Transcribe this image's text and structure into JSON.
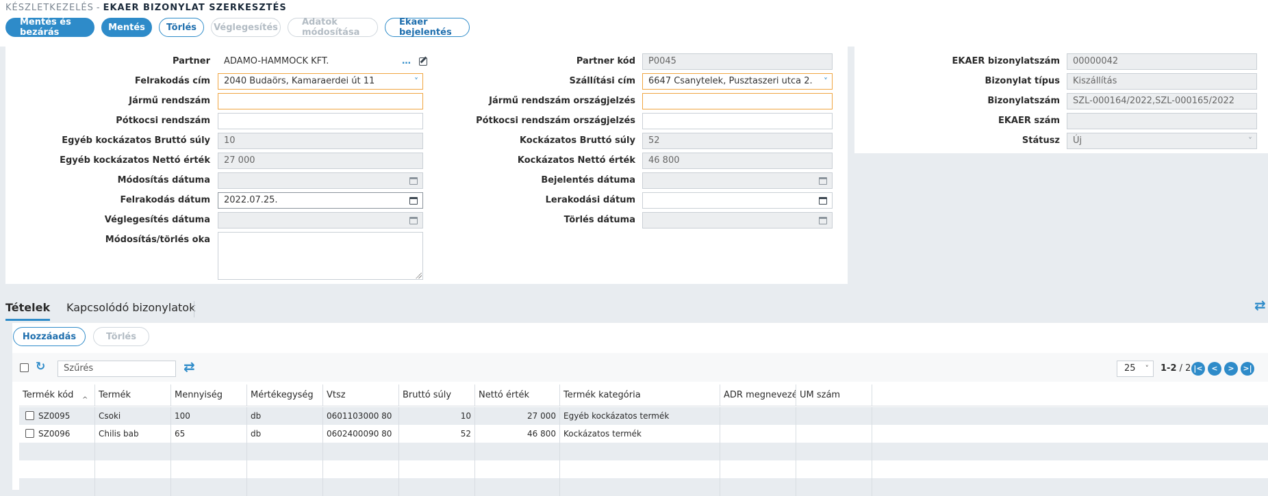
{
  "breadcrumb": {
    "parent": "KÉSZLETKEZELÉS",
    "separator": "-",
    "title": "EKAER BIZONYLAT SZERKESZTÉS"
  },
  "toolbar": {
    "save_close": "Mentés és bezárás",
    "save": "Mentés",
    "delete": "Törlés",
    "finalize": "Véglegesítés",
    "modify_data": "Adatok módosítása",
    "ekaer_report": "Ekaer bejelentés"
  },
  "form_left": {
    "partner": {
      "label": "Partner",
      "value": "ADAMO-HAMMOCK KFT."
    },
    "loading_address": {
      "label": "Felrakodás cím",
      "value": "2040 Budaörs, Kamaraerdei út 11"
    },
    "vehicle_plate": {
      "label": "Jármű rendszám",
      "value": ""
    },
    "trailer_plate": {
      "label": "Pótkocsi rendszám",
      "value": ""
    },
    "other_gross_weight": {
      "label": "Egyéb kockázatos Bruttó súly",
      "value": "10"
    },
    "other_net_value": {
      "label": "Egyéb kockázatos Nettó érték",
      "value": "27 000"
    },
    "modification_date": {
      "label": "Módosítás dátuma",
      "value": ""
    },
    "loading_date": {
      "label": "Felrakodás dátum",
      "value": "2022.07.25."
    },
    "finalize_date": {
      "label": "Véglegesítés dátuma",
      "value": ""
    },
    "reason": {
      "label": "Módosítás/törlés oka",
      "value": ""
    }
  },
  "form_mid": {
    "partner_code": {
      "label": "Partner kód",
      "value": "P0045"
    },
    "shipping_address": {
      "label": "Szállítási cím",
      "value": "6647 Csanytelek, Pusztaszeri utca 2."
    },
    "vehicle_country": {
      "label": "Jármű rendszám országjelzés",
      "value": ""
    },
    "trailer_country": {
      "label": "Pótkocsi rendszám országjelzés",
      "value": ""
    },
    "risk_gross_weight": {
      "label": "Kockázatos Bruttó súly",
      "value": "52"
    },
    "risk_net_value": {
      "label": "Kockázatos Nettó érték",
      "value": "46 800"
    },
    "report_date": {
      "label": "Bejelentés dátuma",
      "value": ""
    },
    "unloading_date": {
      "label": "Lerakodási dátum",
      "value": ""
    },
    "delete_date": {
      "label": "Törlés dátuma",
      "value": ""
    }
  },
  "form_right": {
    "ekaer_doc_no": {
      "label": "EKAER bizonylatszám",
      "value": "00000042"
    },
    "doc_type": {
      "label": "Bizonylat típus",
      "value": "Kiszállítás"
    },
    "doc_no": {
      "label": "Bizonylatszám",
      "value": "SZL-000164/2022,SZL-000165/2022"
    },
    "ekaer_no": {
      "label": "EKAER szám",
      "value": ""
    },
    "status": {
      "label": "Státusz",
      "value": "Új"
    }
  },
  "tabs": [
    {
      "label": "Tételek"
    },
    {
      "label": "Kapcsolódó bizonylatok"
    }
  ],
  "grid": {
    "add": "Hozzáadás",
    "delete": "Törlés",
    "filter_placeholder": "Szűrés",
    "page_size": "25",
    "range": "1-2",
    "total": "2",
    "columns": [
      "Termék kód",
      "Termék",
      "Mennyiség",
      "Mértékegység",
      "Vtsz",
      "Bruttó súly",
      "Nettó érték",
      "Termék kategória",
      "ADR megnevezés",
      "UM szám"
    ],
    "rows": [
      {
        "code": "SZ0095",
        "product": "Csoki",
        "qty": "100",
        "unit": "db",
        "vtsz": "0601103000 80",
        "gross": "10",
        "net": "27 000",
        "category": "Egyéb kockázatos termék",
        "adr": "",
        "um": ""
      },
      {
        "code": "SZ0096",
        "product": "Chilis bab",
        "qty": "65",
        "unit": "db",
        "vtsz": "0602400090 80",
        "gross": "52",
        "net": "46 800",
        "category": "Kockázatos termék",
        "adr": "",
        "um": ""
      }
    ]
  },
  "icons": {
    "dots": "…",
    "dropdown": "˅",
    "sort": "^",
    "refresh": "↻",
    "swap": "⇄",
    "first": "|<",
    "prev": "<",
    "next": ">",
    "last": ">|"
  },
  "colors": {
    "accent": "#2e8bc9",
    "required": "#f0a540",
    "background": "#e8ecf0"
  }
}
